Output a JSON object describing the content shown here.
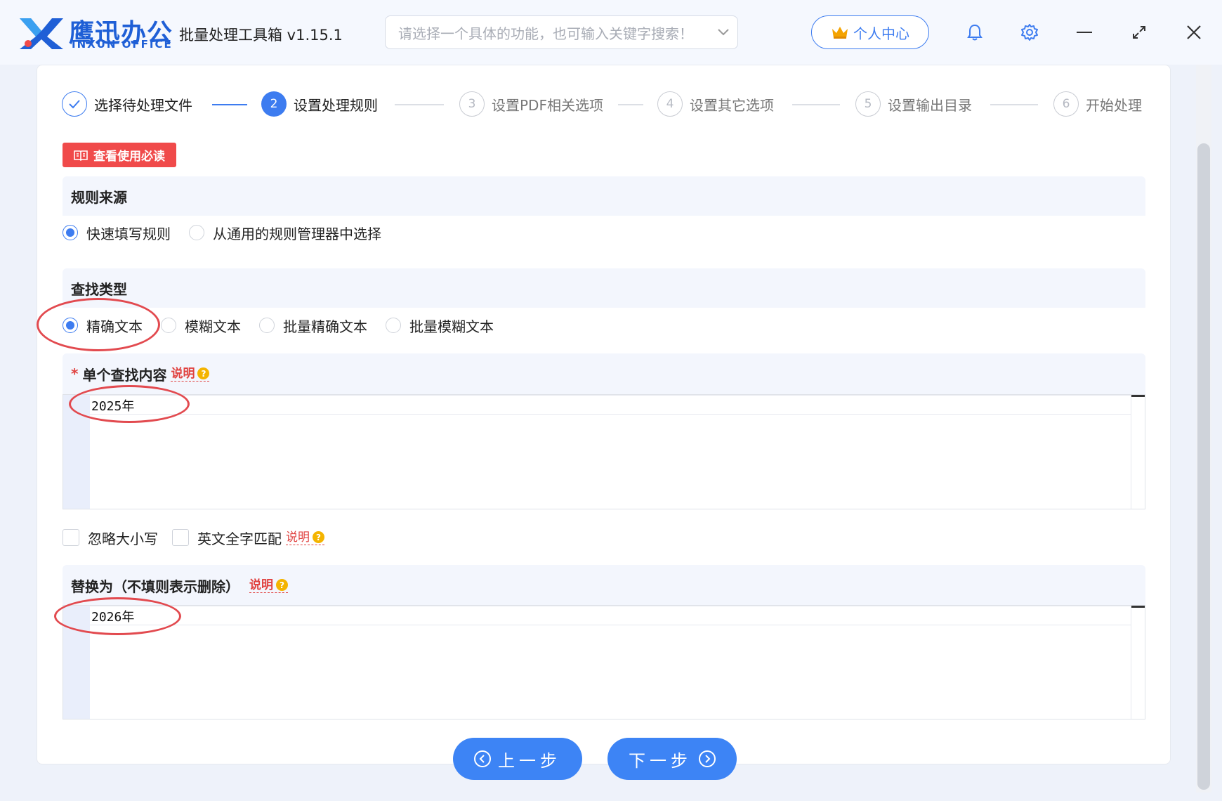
{
  "app": {
    "brand_cn": "鹰迅办公",
    "brand_en": "INXUN OFFICE",
    "title": "批量处理工具箱 v1.15.1"
  },
  "search": {
    "placeholder": "请选择一个具体的功能，也可输入关键字搜索！"
  },
  "header": {
    "user_center": "个人中心"
  },
  "steps": [
    {
      "num": "✓",
      "label": "选择待处理文件",
      "state": "done"
    },
    {
      "num": "2",
      "label": "设置处理规则",
      "state": "active"
    },
    {
      "num": "3",
      "label": "设置PDF相关选项",
      "state": "todo"
    },
    {
      "num": "4",
      "label": "设置其它选项",
      "state": "todo"
    },
    {
      "num": "5",
      "label": "设置输出目录",
      "state": "todo"
    },
    {
      "num": "6",
      "label": "开始处理",
      "state": "todo"
    }
  ],
  "guide_button": "查看使用必读",
  "rule_source": {
    "title": "规则来源",
    "options": [
      "快速填写规则",
      "从通用的规则管理器中选择"
    ],
    "selected": 0
  },
  "find_type": {
    "title": "查找类型",
    "options": [
      "精确文本",
      "模糊文本",
      "批量精确文本",
      "批量模糊文本"
    ],
    "selected": 0
  },
  "find_content": {
    "required_mark": "*",
    "title": "单个查找内容",
    "hint": "说明",
    "value": "2025年"
  },
  "options": {
    "ignore_case": "忽略大小写",
    "whole_word": "英文全字匹配",
    "hint": "说明"
  },
  "replace": {
    "title": "替换为（不填则表示删除）",
    "hint": "说明",
    "value": "2026年"
  },
  "nav": {
    "prev": "上一步",
    "next": "下一步"
  },
  "colors": {
    "accent": "#3d7cf0",
    "danger": "#f04a4a",
    "annotation": "#e24a4f"
  }
}
